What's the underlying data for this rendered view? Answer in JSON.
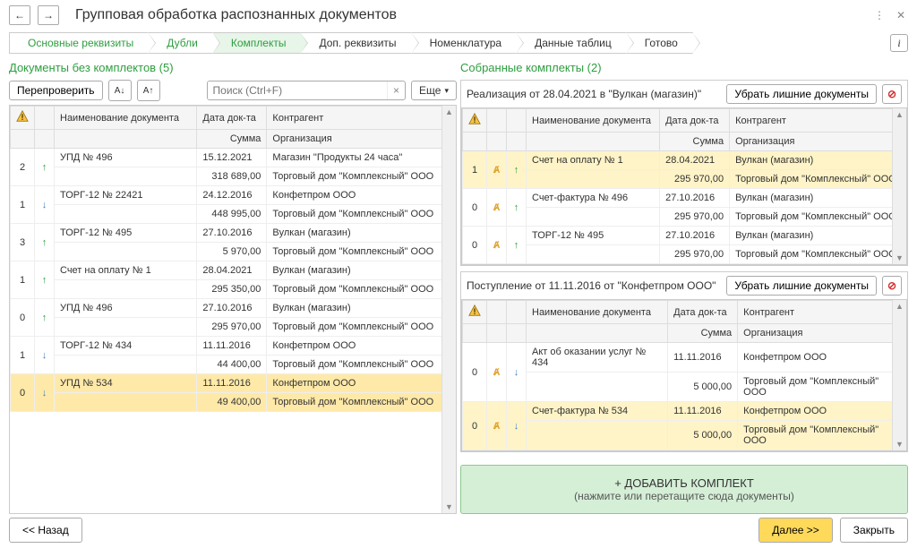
{
  "header": {
    "title": "Групповая обработка распознанных документов"
  },
  "steps": [
    "Основные реквизиты",
    "Дубли",
    "Комплекты",
    "Доп. реквизиты",
    "Номенклатура",
    "Данные таблиц",
    "Готово"
  ],
  "left": {
    "title": "Документы без комплектов (5)",
    "recheck": "Перепроверить",
    "search_ph": "Поиск (Ctrl+F)",
    "more": "Еще",
    "cols": {
      "name": "Наименование документа",
      "date": "Дата док-та",
      "ctr": "Контрагент",
      "sum": "Сумма",
      "org": "Организация"
    },
    "rows": [
      {
        "n": "2",
        "dir": "up",
        "name": "УПД № 496",
        "date": "15.12.2021",
        "ctr": "Магазин \"Продукты 24 часа\"",
        "sum": "318 689,00",
        "org": "Торговый дом \"Комплексный\" ООО"
      },
      {
        "n": "1",
        "dir": "down",
        "name": "ТОРГ-12 № 22421",
        "date": "24.12.2016",
        "ctr": "Конфетпром ООО",
        "sum": "448 995,00",
        "org": "Торговый дом \"Комплексный\" ООО"
      },
      {
        "n": "3",
        "dir": "up",
        "name": "ТОРГ-12 № 495",
        "date": "27.10.2016",
        "ctr": "Вулкан (магазин)",
        "sum": "5 970,00",
        "org": "Торговый дом \"Комплексный\" ООО"
      },
      {
        "n": "1",
        "dir": "up",
        "name": "Счет на оплату № 1",
        "date": "28.04.2021",
        "ctr": "Вулкан (магазин)",
        "sum": "295 350,00",
        "org": "Торговый дом \"Комплексный\" ООО"
      },
      {
        "n": "0",
        "dir": "up",
        "name": "УПД № 496",
        "date": "27.10.2016",
        "ctr": "Вулкан (магазин)",
        "sum": "295 970,00",
        "org": "Торговый дом \"Комплексный\" ООО"
      },
      {
        "n": "1",
        "dir": "down",
        "name": "ТОРГ-12 № 434",
        "date": "11.11.2016",
        "ctr": "Конфетпром ООО",
        "sum": "44 400,00",
        "org": "Торговый дом \"Комплексный\" ООО"
      },
      {
        "n": "0",
        "dir": "down",
        "name": "УПД № 534",
        "date": "11.11.2016",
        "ctr": "Конфетпром ООО",
        "sum": "49 400,00",
        "org": "Торговый дом \"Комплексный\" ООО",
        "sel": true
      }
    ]
  },
  "right": {
    "title": "Собранные комплекты (2)",
    "remove": "Убрать лишние документы",
    "cols": {
      "name": "Наименование документа",
      "date": "Дата док-та",
      "ctr": "Контрагент",
      "sum": "Сумма",
      "org": "Организация"
    },
    "kits": [
      {
        "head": "Реализация от 28.04.2021 в \"Вулкан (магазин)\"",
        "rows": [
          {
            "n": "1",
            "dir": "up",
            "name": "Счет на оплату № 1",
            "date": "28.04.2021",
            "ctr": "Вулкан (магазин)",
            "sum": "295 970,00",
            "org": "Торговый дом \"Комплексный\" ООО",
            "hl": true
          },
          {
            "n": "0",
            "dir": "up",
            "name": "Счет-фактура № 496",
            "date": "27.10.2016",
            "ctr": "Вулкан (магазин)",
            "sum": "295 970,00",
            "org": "Торговый дом \"Комплексный\" ООО"
          },
          {
            "n": "0",
            "dir": "up",
            "name": "ТОРГ-12 № 495",
            "date": "27.10.2016",
            "ctr": "Вулкан (магазин)",
            "sum": "295 970,00",
            "org": "Торговый дом \"Комплексный\" ООО"
          }
        ]
      },
      {
        "head": "Поступление от 11.11.2016 от \"Конфетпром ООО\"",
        "rows": [
          {
            "n": "0",
            "dir": "down",
            "name": "Акт об оказании услуг № 434",
            "date": "11.11.2016",
            "ctr": "Конфетпром ООО",
            "sum": "5 000,00",
            "org": "Торговый дом \"Комплексный\" ООО"
          },
          {
            "n": "0",
            "dir": "down",
            "name": "Счет-фактура № 534",
            "date": "11.11.2016",
            "ctr": "Конфетпром ООО",
            "sum": "5 000,00",
            "org": "Торговый дом \"Комплексный\" ООО",
            "hl": true
          }
        ]
      }
    ],
    "add1": "+ ДОБАВИТЬ КОМПЛЕКТ",
    "add2": "(нажмите или перетащите сюда документы)"
  },
  "footer": {
    "back": "<< Назад",
    "next": "Далее >>",
    "close": "Закрыть"
  }
}
